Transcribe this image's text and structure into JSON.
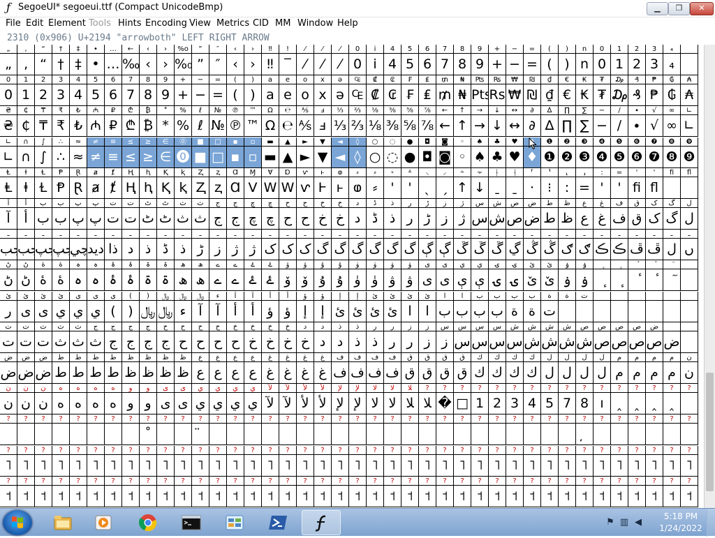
{
  "window": {
    "title": "SegoeUI* segoeui.ttf (Compact UnicodeBmp)",
    "min_label": "▁",
    "max_label": "❐",
    "close_label": "✕"
  },
  "menu": {
    "items": [
      {
        "label": "File",
        "enabled": true
      },
      {
        "label": "Edit",
        "enabled": true
      },
      {
        "label": "Element",
        "enabled": true
      },
      {
        "label": "Tools",
        "enabled": false
      },
      {
        "label": "Hints",
        "enabled": true
      },
      {
        "label": "Encoding",
        "enabled": true
      },
      {
        "label": "View",
        "enabled": true
      },
      {
        "label": "Metrics",
        "enabled": true
      },
      {
        "label": "CID",
        "enabled": true
      },
      {
        "label": "MM",
        "enabled": true
      },
      {
        "label": "Window",
        "enabled": true
      },
      {
        "label": "Help",
        "enabled": true
      }
    ]
  },
  "info_line": "2310 (0x906) U+2194 \"arrowboth\" LEFT RIGHT ARROW",
  "grid": {
    "columns": 40,
    "selected_row": 3,
    "selected_cols": [
      5,
      6,
      7,
      8,
      9,
      10,
      11,
      12,
      13,
      14
    ],
    "selected_extra": [
      [
        3,
        19
      ],
      [
        3,
        20
      ],
      [
        3,
        30
      ]
    ],
    "rows": [
      {
        "labels": "„ ‚ “ † ‡ • … ← ‹ › %o ” ″ ‹ › ‼ ! ⁄ ⁄ ⁄ 0 i 4 5 6 7 8 9 + − = ( ) n 0 1 2 3 ₄",
        "glyphs": "„ ‚ “ † ‡ • … ‰ ‹ › %₀ ” ″ ‹ › ‼ ‾ ⁄ ⁄ ⁄ 0 i 4 5 6 7 8 9 + − = ( ) n 0 1 2 3 ₄"
      },
      {
        "labels": "0 1 2 3 4 5 6 7 8 9 + − = ( ) a e o x ə ₠ ₡ ₢ ₣ ₤ ₥ ₦ ₧ ₨ ₩ ₪ ₫ € ₭ ₮ ₯ ₰ ₱ ₲ ₳",
        "glyphs": "0 1 2 3 4 5 6 7 8 9 + − = ( ) a e o x ə ₠ ₡ ₢ ₣ ₤ ₥ ₦ Pts Rs ₩ ₪ ₫ € ₭ ₮ ₯ ₰ ₱ ₲ ₳"
      },
      {
        "labels": "₴ ₵ ₸ ₹ ₺ ₼ ₽ ₾ ₿ ⃰ % ℓ № ℗ ™ Ω ℮ ⅍ ⅎ ⅓ ⅔ ⅛ ⅜ ⅝ ⅞ ← ↑ → ↓ ↔ ∂ ∆ ∏ ∑ − ∕ ∙ √ ∞ ∟",
        "glyphs": "₴ ₵ ₸ ₹ ₺ ₼ ₽ ₾ ₿ * % ℓ № ℗ ™ Ω ℮ ⅍ ⅎ ⅓ ⅔ ⅛ ⅜ ⅝ ⅞ ← ↑ → ↓ ↔ ∂ ∆ ∏ ∑ − ∕ ∙ √ ∞ ∟"
      },
      {
        "labels": "∟ ∩ ∫ ∴ ≈ ≠ ≡ ≤ ≥ ∈ ⓪ ■ □ ▪ ▫ ▬ ▲ ► ▼ ◄ ◊ ○ ◌ ● ◘ ◙ ◦ ♠ ♣ ♥ ♦ ❶ ❷ ❸ ❹ ❺ ❻ ❼ ❽ ❾",
        "glyphs": "∟ ∩ ∫ ∴ ≈ ≠ ≡ ≤ ≥ ∈ ⓿ ■ □ ▪ ▫ ▬ ▲ ► ▼ ◄ ◊ ○ ◌ ● ◘ ◙ ◦ ♠ ♣ ♥ ♦ ❶ ❷ ❸ ❹ ❺ ❻ ❼ ❽ ❾"
      },
      {
        "labels": "Ⱡ ⱡ Ɫ Ᵽ Ɽ ⱥ ⱦ Ⱨ ⱨ Ⱪ ⱪ Ⱬ ⱬ Ɑ Ɱ Ɐ Ɒ ⱱ ⱶ ⱷ ⸗ ⸗ ⸚ ⸛ ⸜ ⸝ ⸞ ⸟ ⸠ ⸡ ⸢ ⸣ ⸤ ⸥ : = ' ' ﬁ ﬂ",
        "glyphs": "Ⱡ ⱡ Ɫ Ᵽ Ɽ ⱥ ⱦ Ⱨ ⱨ Ⱪ ⱪ Ⱬ ⱬ Ɑ V W W ⱱ Ⱶ ⱶ ⱷ ⸗ ' ' ˎ ˏ ↑ ↓ ˍ ˍ · ⁝ : = ' ' ﬁ ﬂ"
      },
      {
        "labels": "آ أ ب ب پ پ ت ت ٹ ٹ ث ث ج ج چ چ ح ح خ خ د ڈ ذ ر ڑ ز ژ س ش ص ض ط ظ ع غ ف ق ک گ ل",
        "glyphs": "آ أ ب ب پ پ ت ت ٹ ٹ ث ث ج ج چ چ ح ح خ خ د ڈ ذ ر ڑ ز ژ س ش ص ض ط ظ ع غ ف ق ک گ ل"
      },
      {
        "labels": "ـ ـ ـ ـ ـ ـ ـ ـ ـ ـ ـ ـ ـ ـ ـ ـ ـ ـ ـ ـ ـ ـ ـ ـ ـ ـ ـ ـ ـ ـ ـ ـ ـ ـ ـ ـ ـ ـ ـ ـ",
        "glyphs": "جب جب جپ جپ چي ديد ذا د ذ ڈ ذ ڑ ز ژ ژ ک ک ک گ گ گ گ گ گ ڳ ڳ ڱ ڱ ڱ ڲ ڴ ڴ ګ ګ ڪ ڪ ڦ ڦ ل ں"
      },
      {
        "labels": "ڻ ڻ ۀ ۀ ہ ہ ۂ ۂ ۃ ۃ ھ ھ ے ے ۓ ۓ ۆ ۆ ۇ ۇ ۈ ۈ ۋ ۋ ی ی ې ې ۍ ۍ ێ ێ ۏ ۏ ٕ ٕ ٔ ٔ ٓ",
        "glyphs": "ڻ ڻ ۀ ۀ ہ ہ ۂ ۂ ۃ ۃ ھ ھ ے ے ۓ ۓ ۆ ۆ ۇ ۇ ۈ ۈ ۋ ۋ ی ی ې ې ۍ ۍ ێ ێ ۏ ۏ ٕ ٕ ٔ ٔ ٓ"
      },
      {
        "labels": "ئ ئ ئ ئ ی ی ی ( ) ﷼ ﷼ ﷼ ء آ آ أ أ ؤ ؤ إ إ ئ ئ ئ ئ ا ا ب ب ب ب ة ة ت",
        "glyphs": "ر ی ی ي ي ي ( ) ﷼ ﷼ ء آ آ أ أ ؤ ؤ إ إ ئ ئ ئ ئ ا ا ب ب ب ب ة ة ت"
      },
      {
        "labels": "ت ت ث ث ث ج ج ج ج ح ح ح ح خ خ خ خ د د ذ ذ ر ر ز ز س س س س ش ش ش ش ص ص ص ص ض",
        "glyphs": "ت ت ت ث ث ث ج ج ج ج ح ح ح ح خ خ خ خ د د ذ ذ ر ر ز ز س س س س ش ش ش ش ص ص ص ص ض"
      },
      {
        "labels": "ض ض ض ط ط ط ط ظ ظ ظ ظ ع ع ع ع غ غ غ غ ف ف ف ف ق ق ق ق ك ك ك ك ل ل ل ل م م م م ن",
        "glyphs": "ض ض ض ط ط ط ط ظ ظ ظ ظ ع ع ع ع غ غ غ غ ف ف ف ف ق ق ق ق ك ك ك ك ل ل ل ل م م م م ن"
      },
      {
        "labels": "ن ن ن ه ه ه ه و و ى ى ي ي ي ي ﻵ ﻵ ﻷ ﻷ ﻹ ﻹ ﻻ ﻻ ﻼ ? ? ? ? ? ? ? ? ? ? ? ? ? ? ? ?",
        "glyphs": "ن ن ن ه ه ه ه و و ى ى ي ي ي ي ﻵ ﻵ ﻷ ﻷ ﻹ ﻹ ﻻ ﻻ ﻼ ﻼ � □ 1 2 3 4 5 7 8 ı ‸ ‸ ‸ ‸"
      },
      {
        "labels": "? ? ? ? ? ? ? ? ? ? ? ? ? ? ? ? ? ? ? ? ? ? ? ? ? ? ? ? ? ? ? ? ? ? ? ? ? ? ? ?",
        "glyphs": "        ˚   ̈                      ̦    ͏   ͏  ͏  ͏  ͏   ͏  ͏ ͏ ͏ ˙ ˙  ͏ ͏ ͏ ͏ ͏ ͏ ͏ ͏ ͏ ͏ ͏ ͏ ͏ ͏ ‡"
      },
      {
        "labels": "? ? ? ? ? ? ? ? ? ? ? ? ? ? ? ? ? ? ? ? ? ? ? ? ? ? ? ? ? ? ? ? ? ? ? ? ? ? ? ?",
        "glyphs": "˥ ˥ ˥ ˥ ˥ ˥ ˥ ˥ ˥ ˥ ˥ ˥ ˥ ˥ ˥ ˥ ˥ ˥ ˥ ˥ ˥ ˥ ˥ ˥ ˥ ˥ ˥ ˥ ˥ ˥ ˥ ˥ ˥ ˥ ˥ ˥ ˥ ˥ ˥ ˥"
      },
      {
        "labels": "? ? ? ? ? ? ? ? ? ? ? ? ? ? ? ? ? ? ? ? ? ? ? ? ? ? ? ? ? ? ? ? ? ? ? ? ? ? ? ?",
        "glyphs": "˦ ˦ ˦ ˦ ˦ ˦ ˦ ˦ ˦ ˦ ˦ ˦ ˦ ˦ ˦ ˦ ˦ ˦ ˦ ˦ ˦ ˦ ˦ ˦ ˦ ˦ ˦ ˦ ˦ ˦ ˦ ˦ ˦ ˦ ˦ ˦ ˦ ˦ ˦ ˦"
      }
    ],
    "red_rows": [
      11,
      12,
      13,
      14
    ]
  },
  "taskbar": {
    "start_label": "Start",
    "apps": [
      {
        "name": "explorer",
        "active": false
      },
      {
        "name": "media",
        "active": false
      },
      {
        "name": "chrome",
        "active": false
      },
      {
        "name": "cmd",
        "active": false
      },
      {
        "name": "control",
        "active": false
      },
      {
        "name": "powershell",
        "active": false
      },
      {
        "name": "fontforge",
        "active": true
      }
    ],
    "clock_time": "5:18 PM",
    "clock_date": "1/24/2022"
  },
  "colors": {
    "selection": "#7aa5d6",
    "info_text": "#6a7b8c",
    "menu_disabled": "#9a9a9a",
    "taskbar": "#8fb0da"
  }
}
